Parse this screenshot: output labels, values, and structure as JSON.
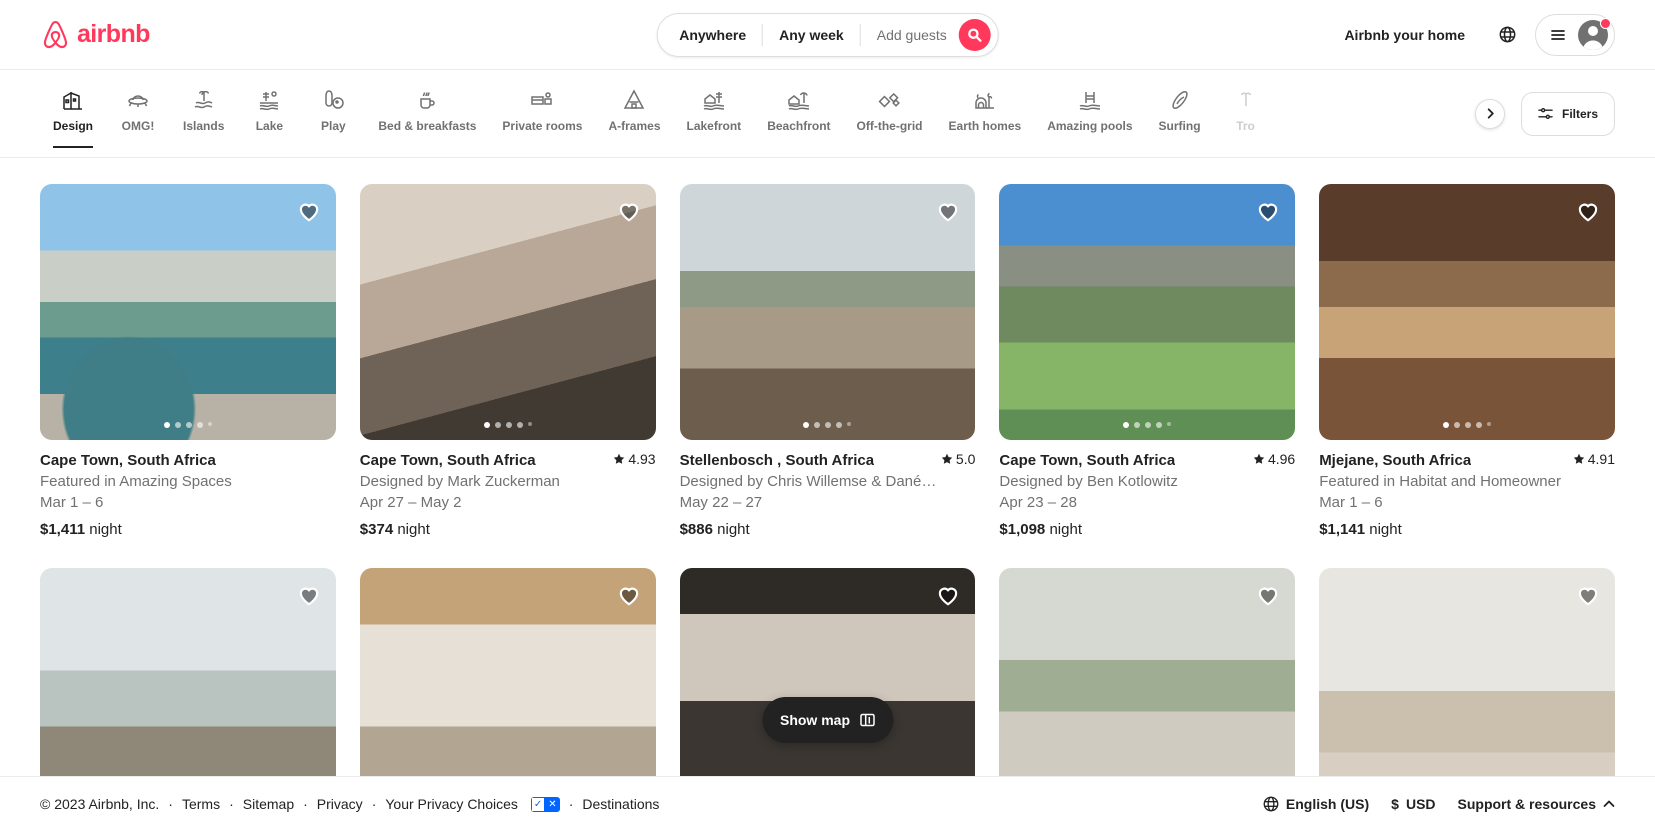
{
  "header": {
    "logo_text": "airbnb",
    "search": {
      "where_label": "Anywhere",
      "when_label": "Any week",
      "guests_placeholder": "Add guests"
    },
    "host_link": "Airbnb your home"
  },
  "categories": {
    "items": [
      {
        "label": "Design",
        "icon": "design-icon",
        "active": true
      },
      {
        "label": "OMG!",
        "icon": "omg-icon",
        "active": false
      },
      {
        "label": "Islands",
        "icon": "islands-icon",
        "active": false
      },
      {
        "label": "Lake",
        "icon": "lake-icon",
        "active": false
      },
      {
        "label": "Play",
        "icon": "play-icon",
        "active": false
      },
      {
        "label": "Bed & breakfasts",
        "icon": "bed-breakfast-icon",
        "active": false
      },
      {
        "label": "Private rooms",
        "icon": "private-room-icon",
        "active": false
      },
      {
        "label": "A-frames",
        "icon": "a-frame-icon",
        "active": false
      },
      {
        "label": "Lakefront",
        "icon": "lakefront-icon",
        "active": false
      },
      {
        "label": "Beachfront",
        "icon": "beachfront-icon",
        "active": false
      },
      {
        "label": "Off-the-grid",
        "icon": "off-the-grid-icon",
        "active": false
      },
      {
        "label": "Earth homes",
        "icon": "earth-home-icon",
        "active": false
      },
      {
        "label": "Amazing pools",
        "icon": "amazing-pools-icon",
        "active": false
      },
      {
        "label": "Surfing",
        "icon": "surfing-icon",
        "active": false
      },
      {
        "label": "Tro",
        "icon": "tropical-icon",
        "active": false
      }
    ],
    "filters_label": "Filters"
  },
  "listings": [
    {
      "title": "Cape Town, South Africa",
      "subtitle": "Featured in Amazing Spaces",
      "dates": "Mar 1 – 6",
      "price": "$1,411",
      "price_unit": "night",
      "rating": "",
      "photo": "ph1",
      "dots": 5,
      "active_dot": 0
    },
    {
      "title": "Cape Town, South Africa",
      "subtitle": "Designed by Mark Zuckerman",
      "dates": "Apr 27 – May 2",
      "price": "$374",
      "price_unit": "night",
      "rating": "4.93",
      "photo": "ph2",
      "dots": 5,
      "active_dot": 0
    },
    {
      "title": "Stellenbosch , South Africa",
      "subtitle": "Designed by Chris Willemse & Dané…",
      "dates": "May 22 – 27",
      "price": "$886",
      "price_unit": "night",
      "rating": "5.0",
      "photo": "ph3",
      "dots": 5,
      "active_dot": 0
    },
    {
      "title": "Cape Town, South Africa",
      "subtitle": "Designed by Ben Kotlowitz",
      "dates": "Apr 23 – 28",
      "price": "$1,098",
      "price_unit": "night",
      "rating": "4.96",
      "photo": "ph4",
      "dots": 5,
      "active_dot": 0
    },
    {
      "title": "Mjejane, South Africa",
      "subtitle": "Featured in Habitat and Homeowner",
      "dates": "Mar 1 – 6",
      "price": "$1,141",
      "price_unit": "night",
      "rating": "4.91",
      "photo": "ph5",
      "dots": 5,
      "active_dot": 0
    },
    {
      "title": "",
      "subtitle": "",
      "dates": "",
      "price": "",
      "price_unit": "",
      "rating": "",
      "photo": "ph6",
      "dots": 0,
      "active_dot": 0
    },
    {
      "title": "",
      "subtitle": "",
      "dates": "",
      "price": "",
      "price_unit": "",
      "rating": "",
      "photo": "ph7",
      "dots": 0,
      "active_dot": 0
    },
    {
      "title": "",
      "subtitle": "",
      "dates": "",
      "price": "",
      "price_unit": "",
      "rating": "",
      "photo": "ph8",
      "dots": 0,
      "active_dot": 0
    },
    {
      "title": "",
      "subtitle": "",
      "dates": "",
      "price": "",
      "price_unit": "",
      "rating": "",
      "photo": "ph9",
      "dots": 0,
      "active_dot": 0
    },
    {
      "title": "",
      "subtitle": "",
      "dates": "",
      "price": "",
      "price_unit": "",
      "rating": "",
      "photo": "ph10",
      "dots": 0,
      "active_dot": 0
    }
  ],
  "show_map": {
    "label": "Show map"
  },
  "footer": {
    "copyright": "© 2023 Airbnb, Inc.",
    "links": [
      "Terms",
      "Sitemap",
      "Privacy",
      "Your Privacy Choices",
      "Destinations"
    ],
    "language": "English (US)",
    "currency_symbol": "$",
    "currency_code": "USD",
    "support": "Support & resources"
  },
  "colors": {
    "brand": "#FF385C",
    "text": "#222222",
    "muted": "#717171",
    "border": "#dddddd",
    "privacy_blue": "#0066ff"
  }
}
